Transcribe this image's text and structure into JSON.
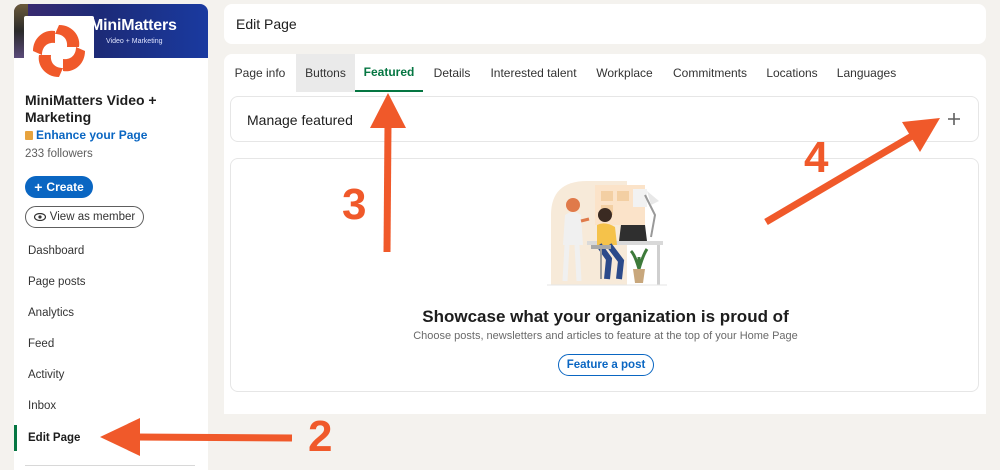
{
  "sidebar": {
    "brand": "MiniMatters",
    "brand_sub": "Video + Marketing",
    "org_name": "MiniMatters Video + Marketing",
    "enhance_label": "Enhance your Page",
    "followers": "233 followers",
    "create_label": "Create",
    "view_member_label": "View as member",
    "nav": [
      {
        "label": "Dashboard"
      },
      {
        "label": "Page posts"
      },
      {
        "label": "Analytics"
      },
      {
        "label": "Feed"
      },
      {
        "label": "Activity"
      },
      {
        "label": "Inbox"
      },
      {
        "label": "Edit Page",
        "active": true
      }
    ]
  },
  "header": {
    "title": "Edit Page"
  },
  "tabs": [
    {
      "label": "Page info"
    },
    {
      "label": "Buttons"
    },
    {
      "label": "Featured",
      "active": true
    },
    {
      "label": "Details"
    },
    {
      "label": "Interested talent"
    },
    {
      "label": "Workplace"
    },
    {
      "label": "Commitments"
    },
    {
      "label": "Locations"
    },
    {
      "label": "Languages"
    }
  ],
  "manage": {
    "title": "Manage featured",
    "add_icon": "plus-icon"
  },
  "showcase": {
    "title": "Showcase what your organization is proud of",
    "subtitle": "Choose posts, newsletters and articles to feature at the top of your Home Page",
    "button_label": "Feature a post"
  },
  "annotations": [
    "2",
    "3",
    "4"
  ],
  "colors": {
    "accent_green": "#057642",
    "link_blue": "#0a66c2",
    "annotation_orange": "#f0592a",
    "background": "#f4f2ee"
  }
}
